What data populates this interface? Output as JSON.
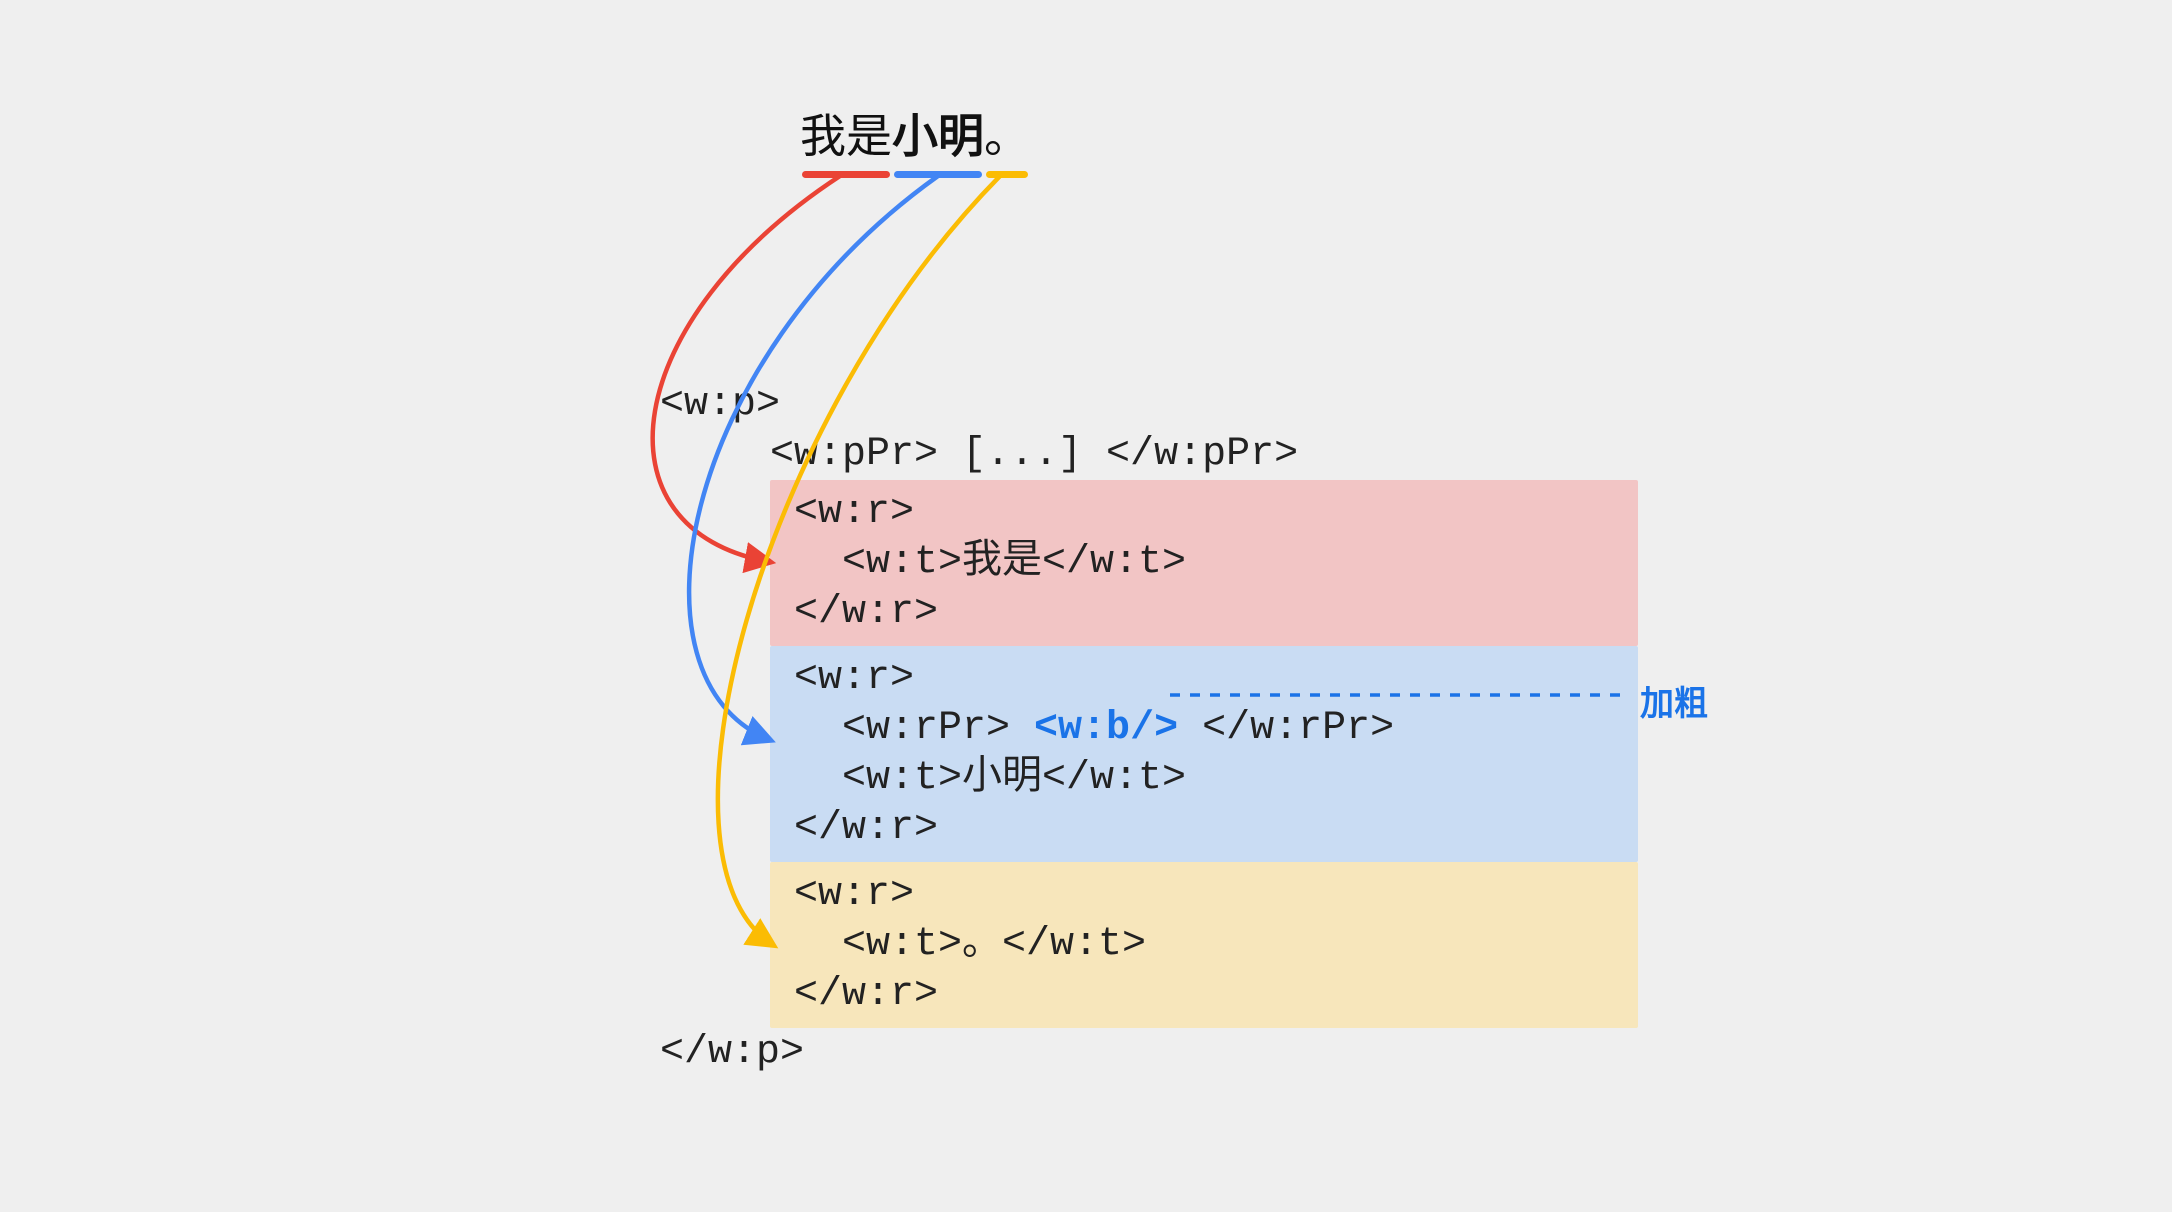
{
  "sentence": {
    "seg1": "我是",
    "seg2": "小明",
    "seg3": "。"
  },
  "code": {
    "open_p": "<w:p>",
    "ppr": "<w:pPr> [...] </w:pPr>",
    "r_open": "<w:r>",
    "r_close": "</w:r>",
    "t1": "  <w:t>我是</w:t>",
    "rpr_prefix": "  <w:rPr> ",
    "bold_tag": "<w:b/>",
    "rpr_suffix": " </w:rPr>",
    "t2": "  <w:t>小明</w:t>",
    "t3": "  <w:t>。</w:t>",
    "close_p": "</w:p>"
  },
  "annotation": "加粗",
  "colors": {
    "red": "#ea4335",
    "blue": "#4285f4",
    "yellow": "#fbbc04",
    "link_blue": "#1a73e8"
  }
}
